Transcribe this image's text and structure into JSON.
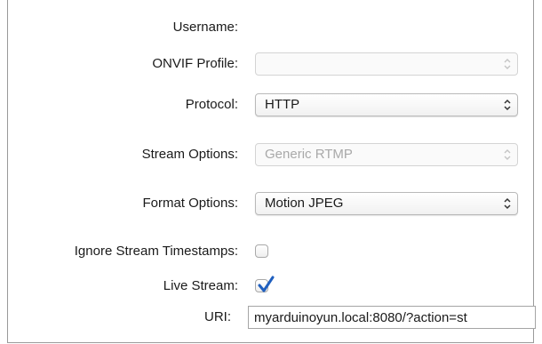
{
  "form": {
    "username": {
      "label": "Username:"
    },
    "onvif_profile": {
      "label": "ONVIF Profile:",
      "value": "",
      "enabled": false
    },
    "protocol": {
      "label": "Protocol:",
      "value": "HTTP",
      "enabled": true
    },
    "stream_options": {
      "label": "Stream Options:",
      "value": "Generic RTMP",
      "enabled": false
    },
    "format_options": {
      "label": "Format Options:",
      "value": "Motion JPEG",
      "enabled": true
    },
    "ignore_timestamps": {
      "label": "Ignore Stream Timestamps:",
      "checked": false
    },
    "live_stream": {
      "label": "Live Stream:",
      "checked": true
    },
    "uri": {
      "label": "URI:",
      "value": "myarduinoyun.local:8080/?action=st"
    }
  },
  "icons": {
    "popup_arrows": "updown-chevron-icon",
    "checkmark": "checkmark-icon"
  },
  "colors": {
    "checkmark": "#1f5fbf",
    "disabled_text": "#a9a9a9"
  }
}
